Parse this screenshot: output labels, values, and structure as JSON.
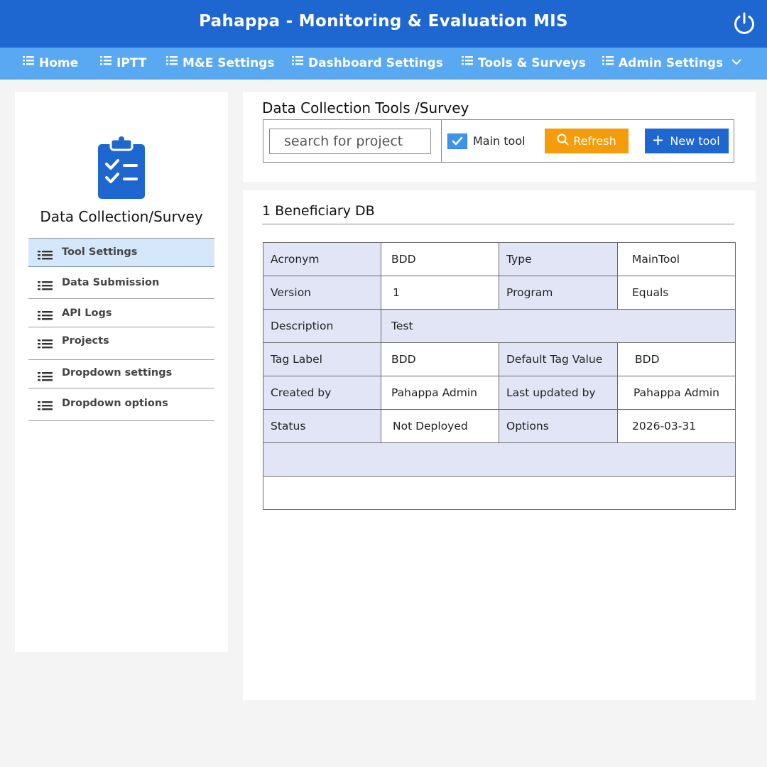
{
  "header": {
    "title": "Pahappa - Monitoring & Evaluation MIS",
    "power_icon": "power-icon"
  },
  "colors": {
    "header_bg": "#1e66d0",
    "nav_bg": "#59a8f2",
    "refresh_btn": "#f59c0b",
    "new_btn": "#1e66d0",
    "active_sidebar": "#d4e7fb",
    "label_cell": "#e1e5f6"
  },
  "nav": {
    "items": [
      {
        "label": "Home"
      },
      {
        "label": "IPTT"
      },
      {
        "label": "M&E Settings"
      },
      {
        "label": "Dashboard Settings"
      },
      {
        "label": "Tools & Surveys"
      },
      {
        "label": "Admin Settings"
      }
    ]
  },
  "sidebar": {
    "icon": "clipboard-check-icon",
    "title": "Data Collection/Survey",
    "items": [
      {
        "label": "Tool Settings",
        "active": true
      },
      {
        "label": "Data Submission"
      },
      {
        "label": "API Logs"
      },
      {
        "label": "Projects"
      },
      {
        "label": "Dropdown settings"
      },
      {
        "label": "Dropdown options"
      }
    ]
  },
  "toolbar": {
    "title": "Data Collection Tools /Survey",
    "search_placeholder": "search for project",
    "main_tool_checked": true,
    "main_tool_label": "Main tool",
    "refresh_label": "Refresh",
    "new_tool_label": "New tool"
  },
  "detail": {
    "title": "1 Beneficiary DB",
    "rows": [
      {
        "k1": "Acronym",
        "v1": "BDD",
        "k2": "Type",
        "v2": "MainTool"
      },
      {
        "k1": "Version",
        "v1": "1",
        "k2": "Program",
        "v2": "Equals"
      },
      {
        "k1": "Description",
        "v1": "Test"
      },
      {
        "k1": "Tag Label",
        "v1": "BDD",
        "k2": "Default Tag Value",
        "v2": "BDD"
      },
      {
        "k1": "Created by",
        "v1": "Pahappa Admin",
        "k2": "Last updated by",
        "v2": "Pahappa Admin"
      },
      {
        "k1": "Status",
        "v1": "Not Deployed",
        "k2": "Options",
        "v2": "2026-03-31"
      }
    ]
  }
}
